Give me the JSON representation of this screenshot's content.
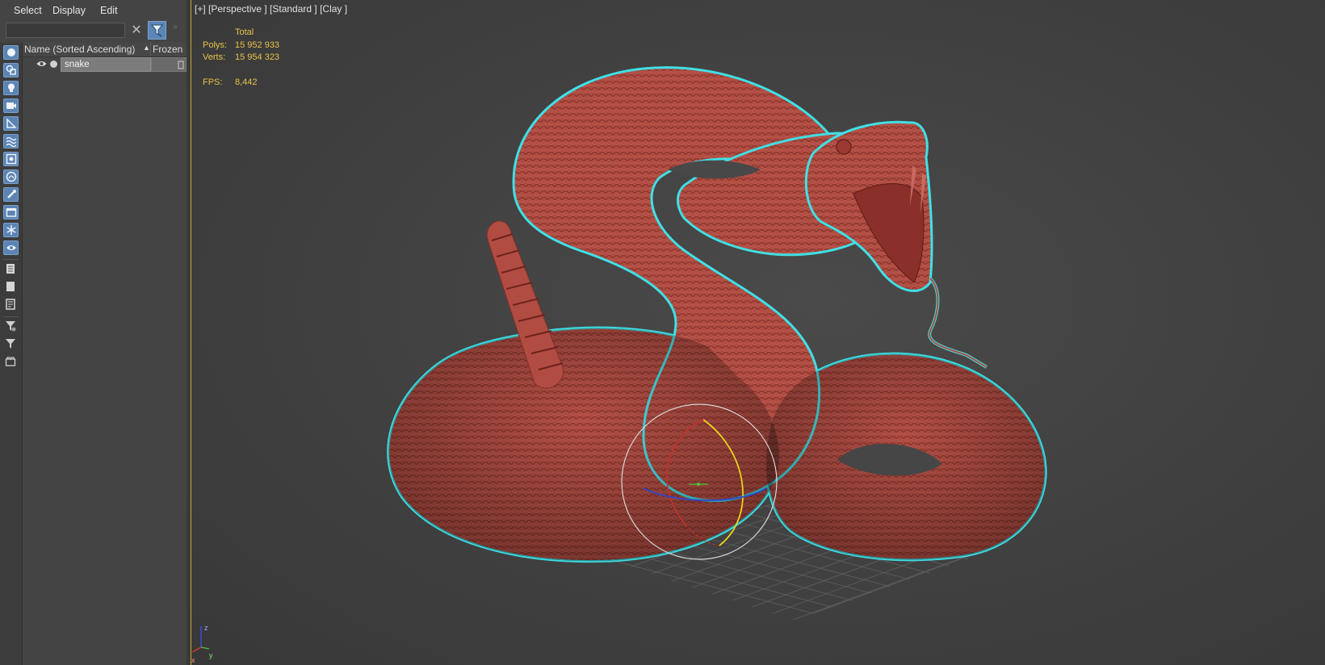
{
  "menu": {
    "select": "Select",
    "display": "Display",
    "edit": "Edit"
  },
  "explorer": {
    "search_value": "",
    "columns": {
      "name": "Name (Sorted Ascending)",
      "frozen": "Frozen"
    },
    "rows": [
      {
        "name": "snake"
      }
    ]
  },
  "viewport": {
    "label": "[+] [Perspective ] [Standard ] [Clay ]",
    "stats": {
      "total_label": "Total",
      "polys_label": "Polys:",
      "polys_value": "15 952 933",
      "verts_label": "Verts:",
      "verts_value": "15 954 323",
      "fps_label": "FPS:",
      "fps_value": "8,442"
    },
    "axis": {
      "z": "z",
      "x": "x",
      "y": "y"
    }
  },
  "colors": {
    "accent": "#5b84b4",
    "stats_text": "#e8c34a",
    "selection_outline": "#3fe0e6",
    "model_clay": "#b24d43"
  }
}
